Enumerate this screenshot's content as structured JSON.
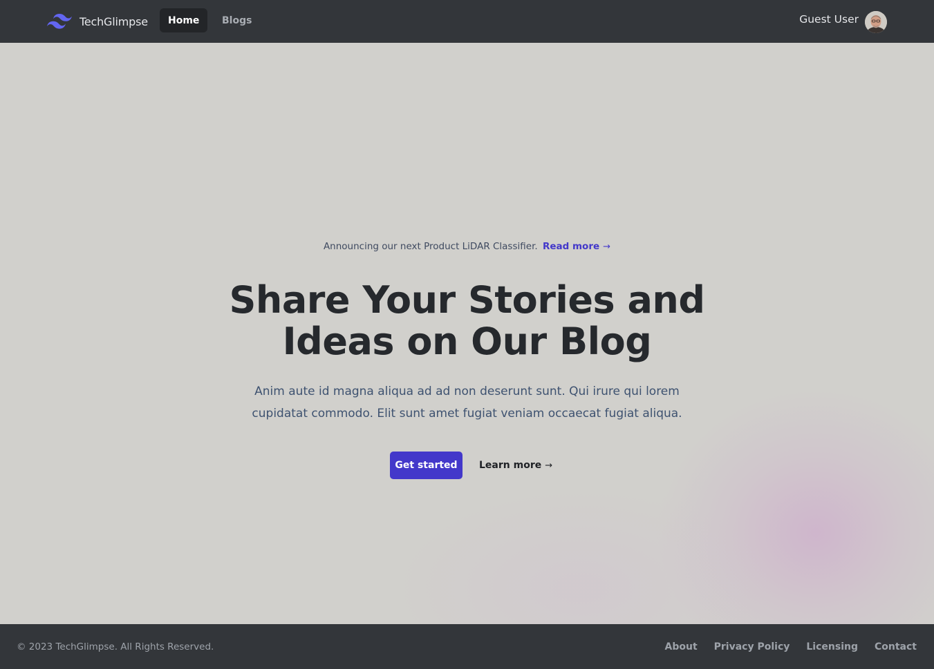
{
  "nav": {
    "brand": "TechGlimpse",
    "links": [
      {
        "label": "Home",
        "active": true
      },
      {
        "label": "Blogs",
        "active": false
      }
    ],
    "user_name": "Guest User"
  },
  "hero": {
    "announcement": "Announcing our next Product LiDAR Classifier.",
    "read_more": "Read more",
    "arrow": "→",
    "headline_line1": "Share Your Stories and",
    "headline_line2": "Ideas on Our Blog",
    "subtitle": "Anim aute id magna aliqua ad ad non deserunt sunt. Qui irure qui lorem cupidatat commodo. Elit sunt amet fugiat veniam occaecat fugiat aliqua.",
    "primary_button": "Get started",
    "secondary_button": "Learn more"
  },
  "footer": {
    "copyright": "© 2023 TechGlimpse. All Rights Reserved.",
    "links": [
      "About",
      "Privacy Policy",
      "Licensing",
      "Contact"
    ]
  },
  "colors": {
    "nav_bg": "#33363a",
    "page_bg": "#d1d0cc",
    "accent": "#4338ca",
    "logo": "#6366f1"
  }
}
